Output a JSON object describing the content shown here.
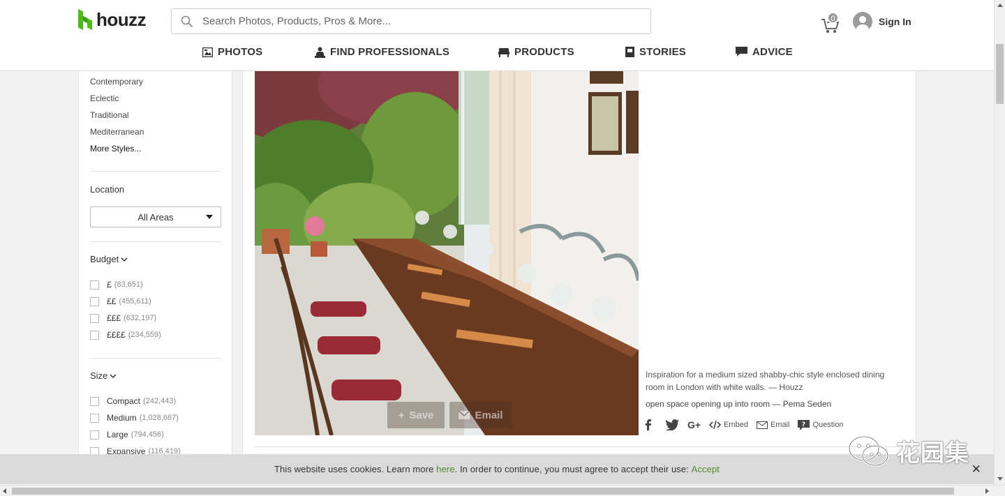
{
  "header": {
    "logo_text": "houzz",
    "search_placeholder": "Search Photos, Products, Pros & More...",
    "cart_count": "0",
    "signin_label": "Sign In",
    "brand_color": "#4dbc15"
  },
  "nav": [
    {
      "label": "PHOTOS",
      "icon": "photos-icon"
    },
    {
      "label": "FIND PROFESSIONALS",
      "icon": "professional-icon"
    },
    {
      "label": "PRODUCTS",
      "icon": "products-icon"
    },
    {
      "label": "STORIES",
      "icon": "stories-icon"
    },
    {
      "label": "ADVICE",
      "icon": "advice-icon"
    }
  ],
  "sidebar": {
    "styles": [
      "Contemporary",
      "Eclectic",
      "Traditional",
      "Mediterranean"
    ],
    "more_styles": "More Styles...",
    "location": {
      "title": "Location",
      "value": "All Areas"
    },
    "budget": {
      "title": "Budget",
      "items": [
        {
          "label": "£",
          "count": "(83,651)"
        },
        {
          "label": "££",
          "count": "(455,611)"
        },
        {
          "label": "£££",
          "count": "(632,197)"
        },
        {
          "label": "££££",
          "count": "(234,559)"
        }
      ]
    },
    "size": {
      "title": "Size",
      "items": [
        {
          "label": "Compact",
          "count": "(242,443)"
        },
        {
          "label": "Medium",
          "count": "(1,028,667)"
        },
        {
          "label": "Large",
          "count": "(794,456)"
        },
        {
          "label": "Expansive",
          "count": "(116,419)"
        }
      ]
    }
  },
  "main": {
    "photo_buttons": {
      "save": "Save",
      "email": "Email"
    },
    "caption": "Inspiration for a medium sized shabby-chic style enclosed dining room in London with white walls. — Houzz",
    "caption_note": "open space opening up into room — Pema Seden",
    "share": {
      "embed": "Embed",
      "email": "Email",
      "question": "Question"
    }
  },
  "cookie": {
    "text_before": "This website uses cookies. Learn more ",
    "link_here": "here",
    "text_after": ". In order to continue, you must agree to accept their use: ",
    "accept": "Accept",
    "close": "✕"
  },
  "watermark": {
    "text": "花园集"
  }
}
